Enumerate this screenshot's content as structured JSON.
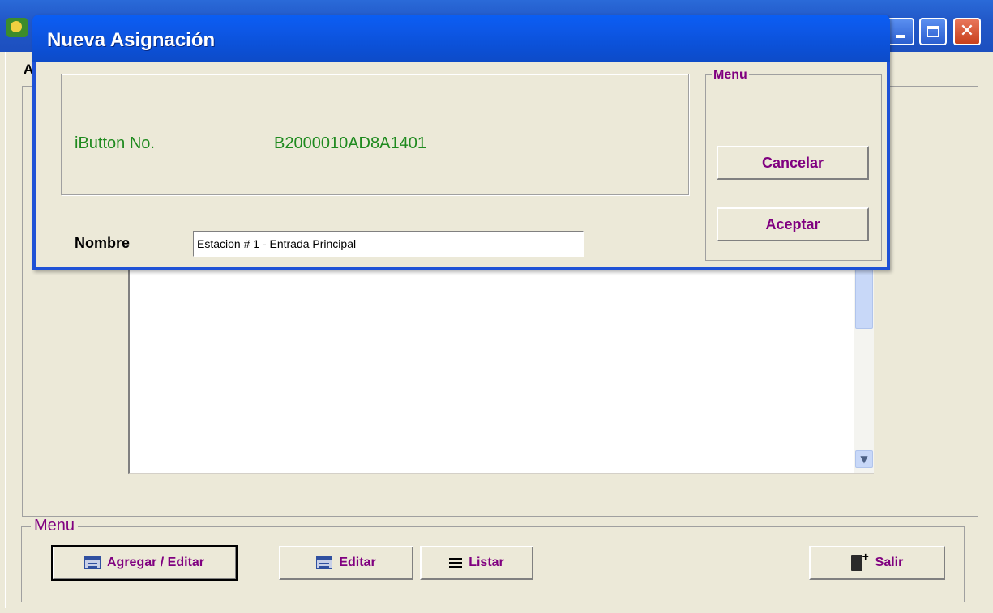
{
  "main_window": {
    "partial_label": "A",
    "bottom_menu": {
      "legend": "Menu",
      "buttons": {
        "agregar": "Agregar / Editar",
        "editar": "Editar",
        "listar": "Listar",
        "salir": "Salir"
      }
    }
  },
  "dialog": {
    "title": "Nueva Asignación",
    "ibutton_label": "iButton No.",
    "ibutton_value": "B2000010AD8A1401",
    "nombre_label": "Nombre",
    "nombre_value": "Estacion # 1 - Entrada Principal",
    "menu": {
      "legend": "Menu",
      "cancel": "Cancelar",
      "accept": "Aceptar"
    }
  },
  "colors": {
    "accent_purple": "#800080",
    "label_green": "#1e8a1e",
    "title_blue": "#0c50d6"
  }
}
